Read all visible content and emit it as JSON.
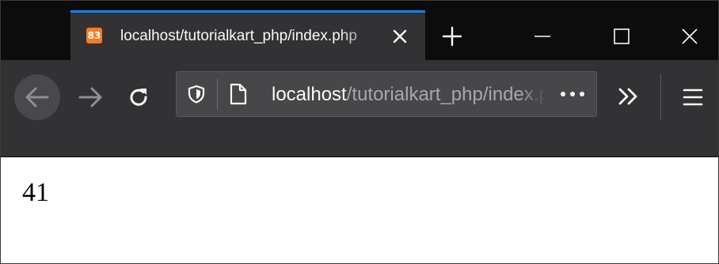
{
  "browser": {
    "tab": {
      "favicon_text": "83",
      "favicon_icon": "xampp-icon",
      "title": "localhost/tutorialkart_php/index.php"
    },
    "url": {
      "host": "localhost",
      "path": "/tutorialkart_php/index.php"
    },
    "icons": {
      "tab_close": "close-icon",
      "new_tab": "plus-icon",
      "minimize": "minimize-icon",
      "maximize": "maximize-icon",
      "window_close": "close-icon",
      "back": "arrow-left-icon",
      "forward": "arrow-right-icon",
      "reload": "reload-icon",
      "tracking_protection": "shield-icon",
      "page_info": "page-icon",
      "page_actions": "ellipsis-icon",
      "overflow": "chevron-double-right-icon",
      "menu": "hamburger-menu-icon"
    },
    "colors": {
      "tab_strip": "#0c0c0d",
      "toolbar": "#323234",
      "active_tab_accent": "#0a84ff",
      "favicon_bg": "#fb7a24"
    }
  },
  "page": {
    "output": "41"
  }
}
